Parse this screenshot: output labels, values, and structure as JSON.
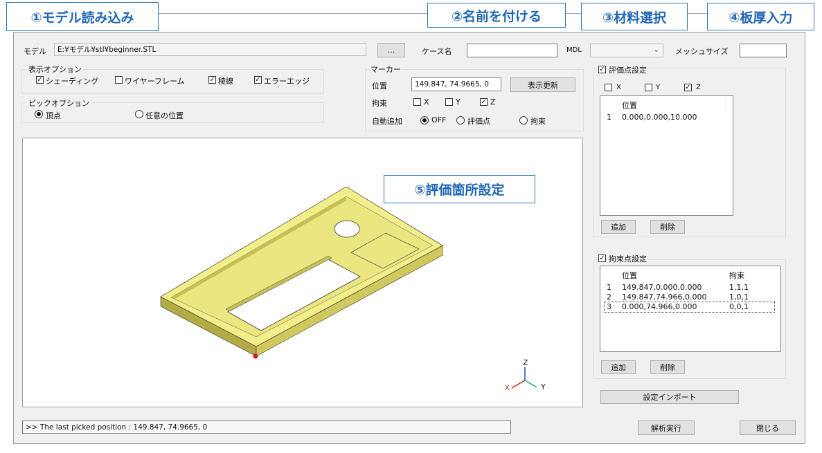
{
  "callouts": {
    "c1": "①モデル読み込み",
    "c2": "②名前を付ける",
    "c3": "③材料選択",
    "c4": "④板厚入力",
    "c5": "⑤評価箇所設定"
  },
  "top": {
    "model_label": "モデル",
    "model_path": "E:¥モデル¥stl¥beginner.STL",
    "browse_label": "...",
    "case_label": "ケース名",
    "case_value": "",
    "mdl_label": "MDL",
    "mdl_value": "",
    "mesh_label": "メッシュサイズ",
    "mesh_value": ""
  },
  "display_options": {
    "title": "表示オプション",
    "items": [
      {
        "label": "シェーディング",
        "checked": true
      },
      {
        "label": "ワイヤーフレーム",
        "checked": false
      },
      {
        "label": "稜線",
        "checked": true
      },
      {
        "label": "エラーエッジ",
        "checked": true
      }
    ]
  },
  "pick_options": {
    "title": "ピックオプション",
    "items": [
      {
        "label": "頂点",
        "selected": true
      },
      {
        "label": "任意の位置",
        "selected": false
      }
    ]
  },
  "marker": {
    "title": "マーカー",
    "position_label": "位置",
    "position_value": "149.847, 74.9665, 0",
    "refresh_label": "表示更新",
    "constraint_label": "拘束",
    "x_label": "X",
    "x_checked": false,
    "y_label": "Y",
    "y_checked": false,
    "z_label": "Z",
    "z_checked": true,
    "auto_add_label": "自動追加",
    "auto_options": [
      {
        "label": "OFF",
        "selected": true
      },
      {
        "label": "評価点",
        "selected": false
      },
      {
        "label": "拘束",
        "selected": false
      }
    ]
  },
  "eval_points": {
    "title": "評価点設定",
    "checked": true,
    "x_label": "X",
    "x_checked": false,
    "y_label": "Y",
    "y_checked": false,
    "z_label": "Z",
    "z_checked": true,
    "header_position": "位置",
    "rows": [
      {
        "index": "1",
        "position": "0.000,0.000,10.000"
      }
    ],
    "add_label": "追加",
    "delete_label": "削除"
  },
  "constraint_points": {
    "title": "拘束点設定",
    "checked": true,
    "header_position": "位置",
    "header_constraint": "拘束",
    "rows": [
      {
        "index": "1",
        "position": "149.847,0.000,0.000",
        "constraint": "1,1,1"
      },
      {
        "index": "2",
        "position": "149.847,74.966,0.000",
        "constraint": "1,0,1"
      },
      {
        "index": "3",
        "position": "0.000,74.966,0.000",
        "constraint": "0,0,1"
      }
    ],
    "add_label": "追加",
    "delete_label": "削除"
  },
  "import_label": "設定インポート",
  "status_text": ">> The last picked position : 149.847, 74.9665, 0",
  "run_label": "解析実行",
  "close_label": "閉じる",
  "axes": {
    "z": "Z",
    "y": "Y",
    "x": "X"
  },
  "colors": {
    "accent": "#2e74b5",
    "model_fill": "#f2ee8a",
    "model_dark": "#b3ab45",
    "marker": "#d01a1a"
  }
}
